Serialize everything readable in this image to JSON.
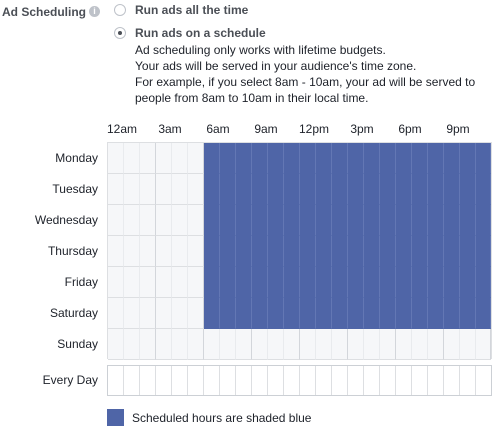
{
  "section": {
    "label": "Ad Scheduling",
    "info_glyph": "i"
  },
  "options": [
    {
      "label": "Run ads all the time",
      "checked": false
    },
    {
      "label": "Run ads on a schedule",
      "checked": true
    }
  ],
  "help_lines": [
    "Ad scheduling only works with lifetime budgets.",
    "Your ads will be served in your audience's time zone.",
    "For example, if you select 8am - 10am, your ad will be served to",
    "people from 8am to 10am in their local time."
  ],
  "hour_labels": [
    "12am",
    "3am",
    "6am",
    "9am",
    "12pm",
    "3pm",
    "6pm",
    "9pm"
  ],
  "days": [
    {
      "name": "Monday",
      "scheduled_hours": [
        6,
        24
      ]
    },
    {
      "name": "Tuesday",
      "scheduled_hours": [
        6,
        24
      ]
    },
    {
      "name": "Wednesday",
      "scheduled_hours": [
        6,
        24
      ]
    },
    {
      "name": "Thursday",
      "scheduled_hours": [
        6,
        24
      ]
    },
    {
      "name": "Friday",
      "scheduled_hours": [
        6,
        24
      ]
    },
    {
      "name": "Saturday",
      "scheduled_hours": [
        6,
        24
      ]
    },
    {
      "name": "Sunday",
      "scheduled_hours": null
    }
  ],
  "every_day": {
    "label": "Every Day",
    "scheduled_hours": null
  },
  "legend": {
    "text": "Scheduled hours are shaded blue",
    "color": "#4f65a7"
  },
  "colors": {
    "scheduled": "#4f65a7",
    "unscheduled": "#f6f7f9"
  }
}
